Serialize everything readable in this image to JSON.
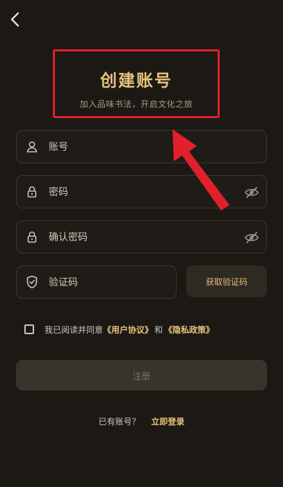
{
  "header": {
    "title": "创建账号",
    "subtitle": "加入品味书法，开启文化之旅"
  },
  "form": {
    "account_placeholder": "账号",
    "password_placeholder": "密码",
    "confirm_placeholder": "确认密码",
    "code_placeholder": "验证码",
    "get_code_label": "获取验证码"
  },
  "agreement": {
    "prefix": "我已阅读并同意",
    "user_agreement": "《用户协议》",
    "and": "和",
    "privacy_policy": "《隐私政策》"
  },
  "actions": {
    "register_label": "注册"
  },
  "footer": {
    "has_account": "已有账号？",
    "login_now": "立即登录"
  },
  "icons": {
    "back": "chevron-left-icon",
    "account": "user-icon",
    "password": "lock-icon",
    "confirm": "lock-icon",
    "code": "shield-check-icon",
    "visibility": "eye-off-icon"
  },
  "colors": {
    "background": "#1c1914",
    "accent": "#e8c27d",
    "highlight": "#e2202c"
  }
}
